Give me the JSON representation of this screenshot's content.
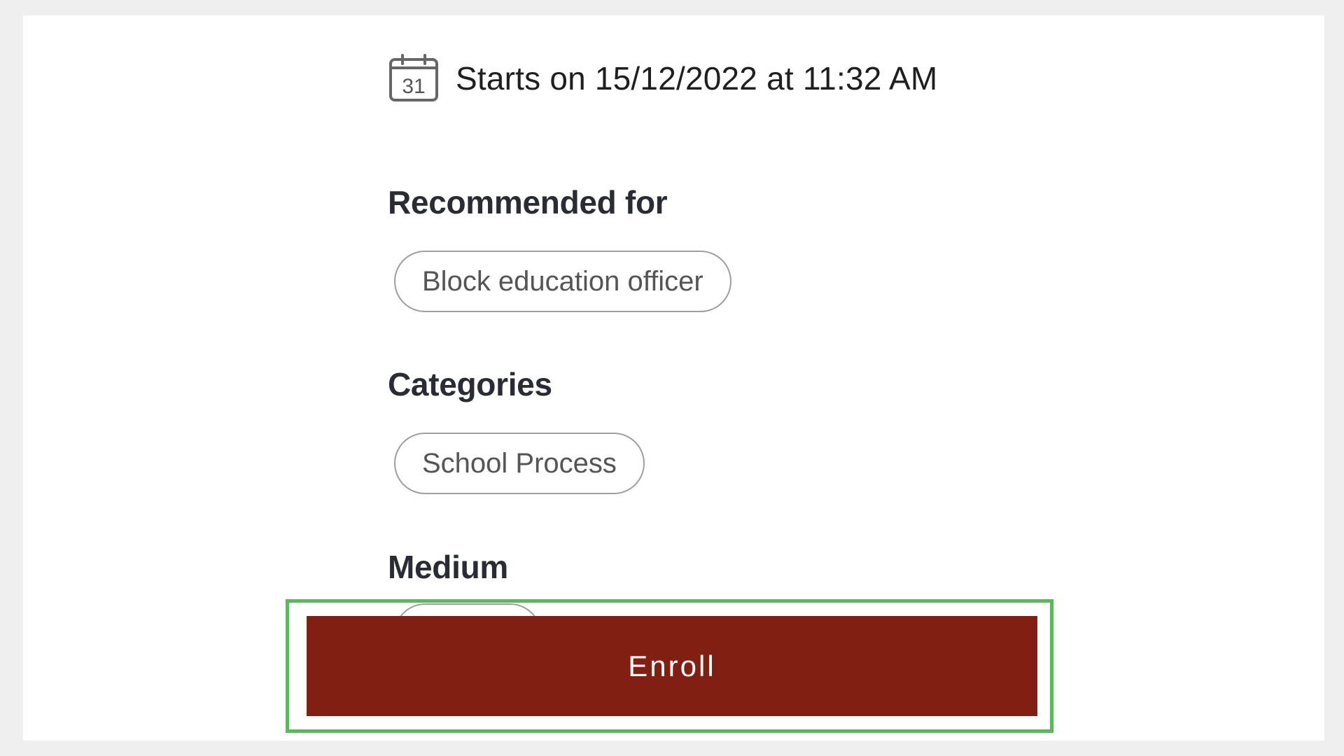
{
  "schedule": {
    "calendar_icon_day": "31",
    "start_text": "Starts on 15/12/2022 at 11:32 AM"
  },
  "recommended": {
    "heading": "Recommended for",
    "chips": [
      "Block education officer"
    ]
  },
  "categories": {
    "heading": "Categories",
    "chips": [
      "School Process"
    ]
  },
  "medium": {
    "heading": "Medium"
  },
  "actions": {
    "enroll_label": "Enroll"
  },
  "colors": {
    "enroll_bg": "#821f13",
    "highlight_border": "#5cb85c",
    "chip_border": "#9e9e9e",
    "page_bg": "#efefef"
  }
}
